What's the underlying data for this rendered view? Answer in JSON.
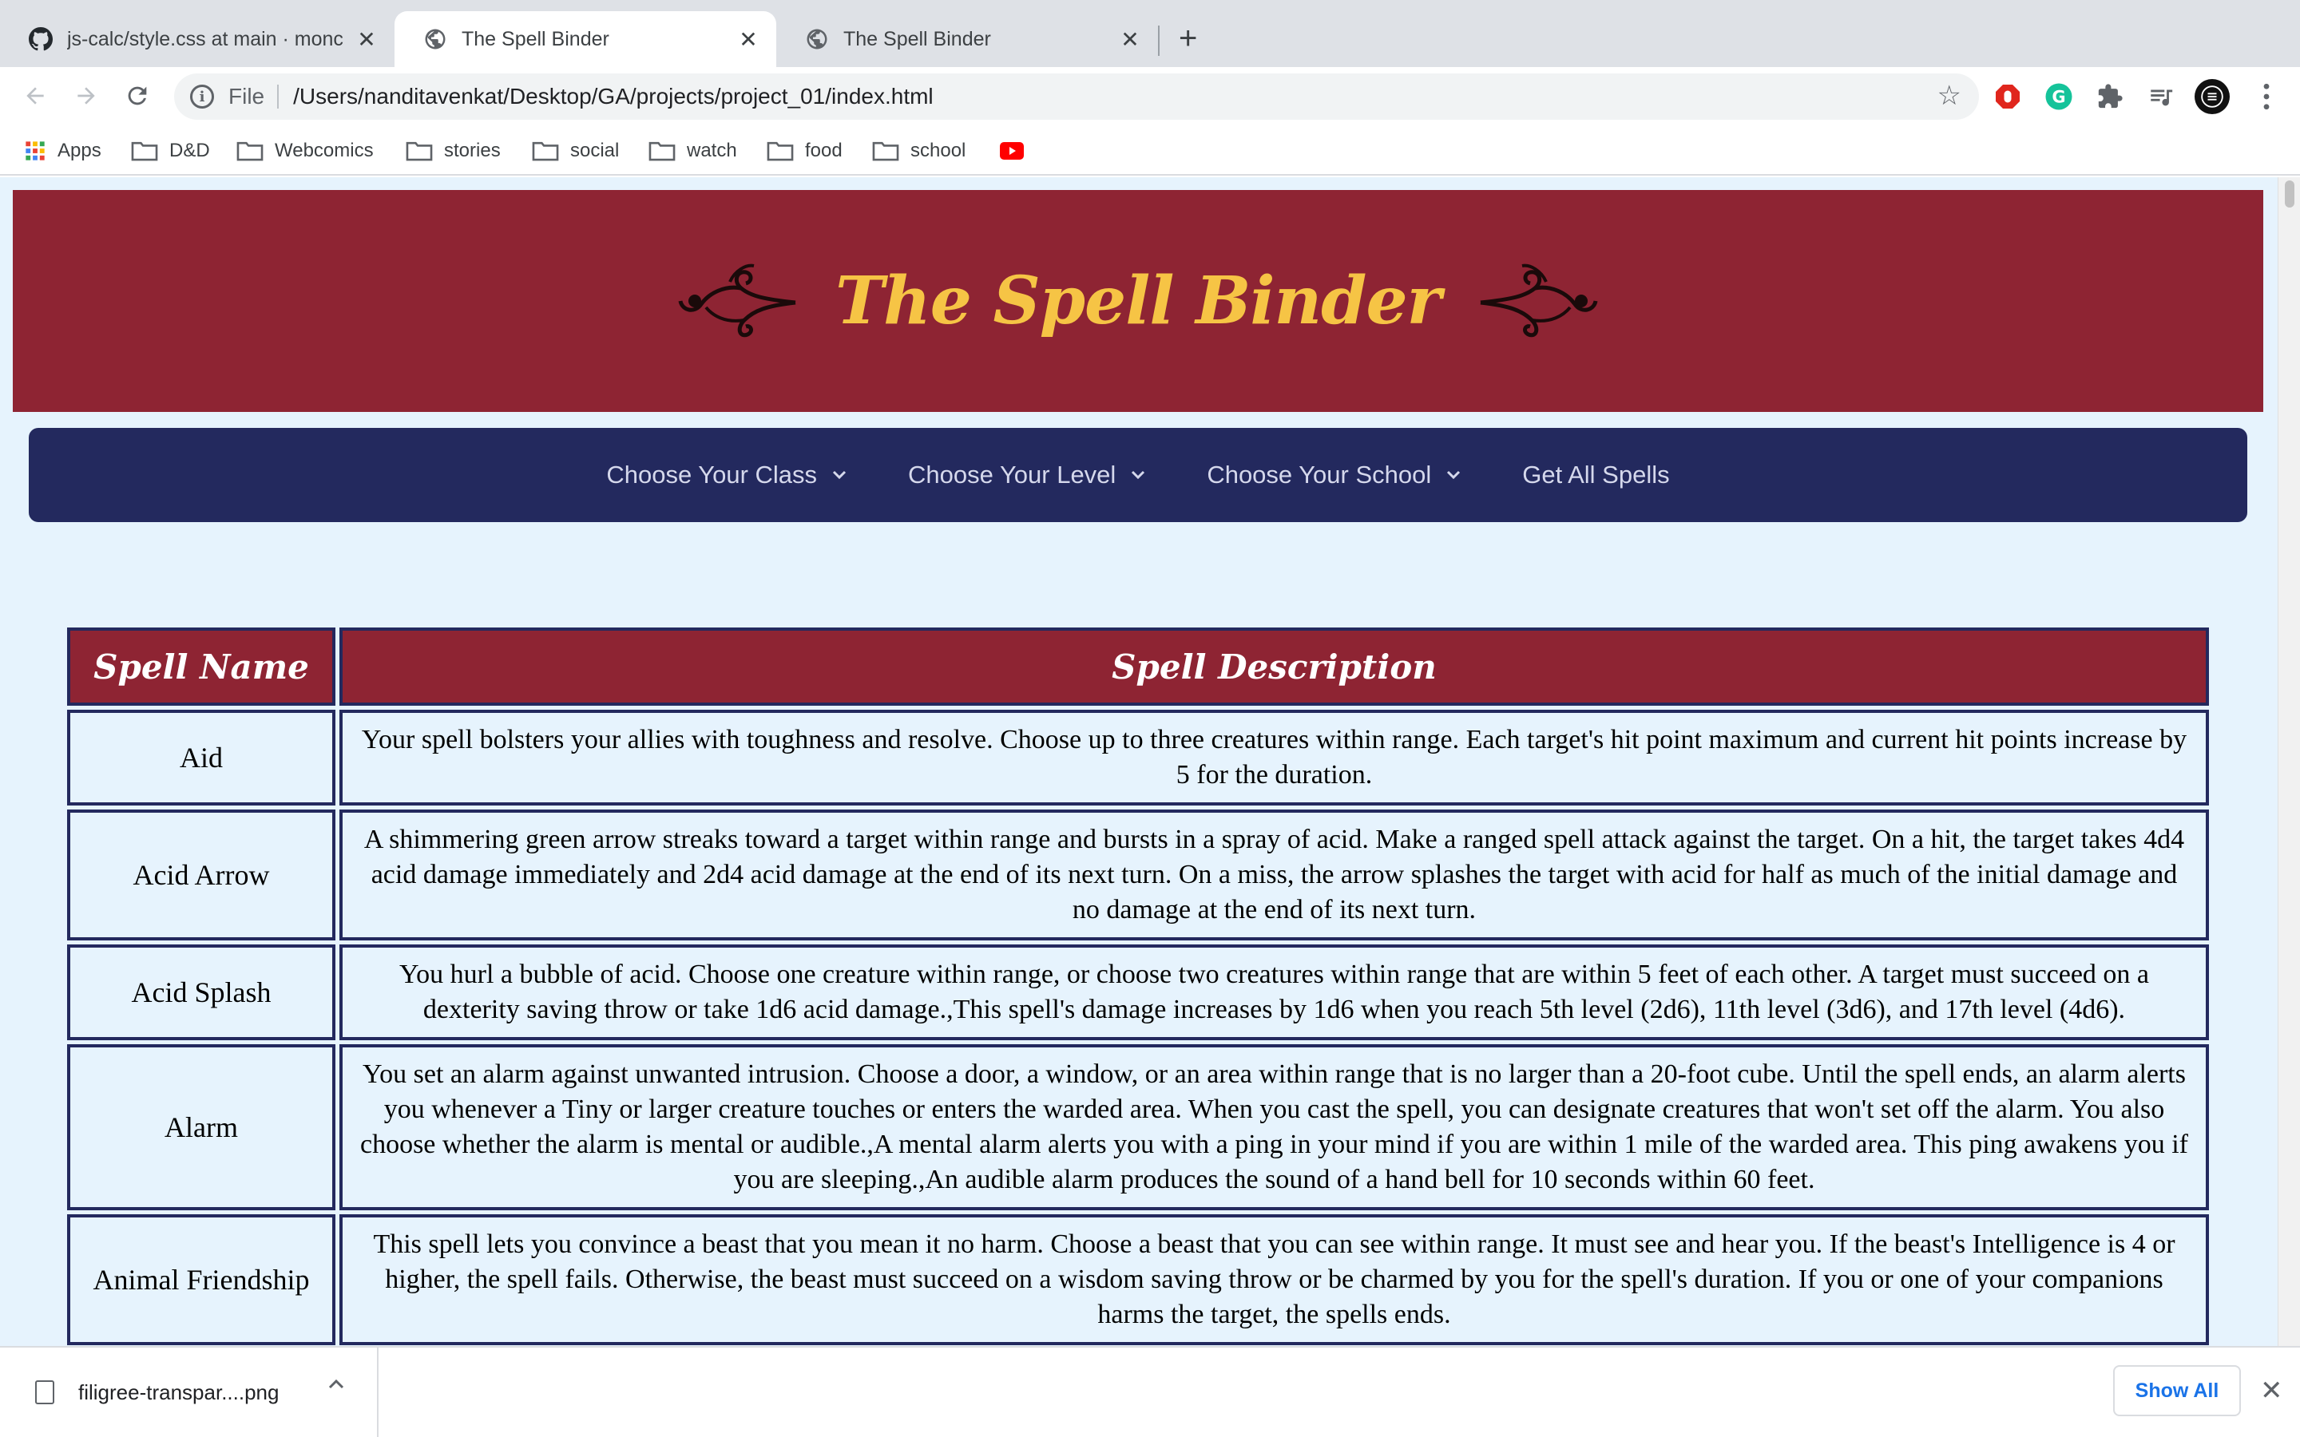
{
  "browser": {
    "tabs": [
      {
        "title": "js-calc/style.css at main · monc",
        "icon": "github-icon"
      },
      {
        "title": "The Spell Binder",
        "icon": "globe-icon"
      },
      {
        "title": "The Spell Binder",
        "icon": "globe-icon"
      }
    ],
    "address": {
      "scheme": "File",
      "url": "/Users/nanditavenkat/Desktop/GA/projects/project_01/index.html"
    },
    "bookmarks": [
      {
        "label": "Apps",
        "icon": "apps-grid-icon"
      },
      {
        "label": "D&D",
        "icon": "folder-icon"
      },
      {
        "label": "Webcomics",
        "icon": "folder-icon"
      },
      {
        "label": "stories",
        "icon": "folder-icon"
      },
      {
        "label": "social",
        "icon": "folder-icon"
      },
      {
        "label": "watch",
        "icon": "folder-icon"
      },
      {
        "label": "food",
        "icon": "folder-icon"
      },
      {
        "label": "school",
        "icon": "folder-icon"
      },
      {
        "label": "",
        "icon": "youtube-icon"
      }
    ]
  },
  "page": {
    "title": "The Spell Binder",
    "nav": {
      "class_label": "Choose Your Class",
      "level_label": "Choose Your Level",
      "school_label": "Choose Your School",
      "all_label": "Get All Spells"
    },
    "table": {
      "headers": {
        "name": "Spell Name",
        "description": "Spell Description"
      },
      "rows": [
        {
          "name": "Aid",
          "description": "Your spell bolsters your allies with toughness and resolve. Choose up to three creatures within range. Each target's hit point maximum and current hit points increase by 5 for the duration."
        },
        {
          "name": "Acid Arrow",
          "description": "A shimmering green arrow streaks toward a target within range and bursts in a spray of acid. Make a ranged spell attack against the target. On a hit, the target takes 4d4 acid damage immediately and 2d4 acid damage at the end of its next turn. On a miss, the arrow splashes the target with acid for half as much of the initial damage and no damage at the end of its next turn."
        },
        {
          "name": "Acid Splash",
          "description": "You hurl a bubble of acid. Choose one creature within range, or choose two creatures within range that are within 5 feet of each other. A target must succeed on a dexterity saving throw or take 1d6 acid damage.,This spell's damage increases by 1d6 when you reach 5th level (2d6), 11th level (3d6), and 17th level (4d6)."
        },
        {
          "name": "Alarm",
          "description": "You set an alarm against unwanted intrusion. Choose a door, a window, or an area within range that is no larger than a 20-foot cube. Until the spell ends, an alarm alerts you whenever a Tiny or larger creature touches or enters the warded area. When you cast the spell, you can designate creatures that won't set off the alarm. You also choose whether the alarm is mental or audible.,A mental alarm alerts you with a ping in your mind if you are within 1 mile of the warded area. This ping awakens you if you are sleeping.,An audible alarm produces the sound of a hand bell for 10 seconds within 60 feet."
        },
        {
          "name": "Animal Friendship",
          "description": "This spell lets you convince a beast that you mean it no harm. Choose a beast that you can see within range. It must see and hear you. If the beast's Intelligence is 4 or higher, the spell fails. Otherwise, the beast must succeed on a wisdom saving throw or be charmed by you for the spell's duration. If you or one of your companions harms the target, the spells ends."
        }
      ]
    }
  },
  "downloads": {
    "file_name": "filigree-transpar....png",
    "show_all_label": "Show All"
  },
  "colors": {
    "banner": "#8e2433",
    "title_gold": "#f6c445",
    "navbar": "#23295e",
    "page_bg": "#e6f3fd"
  }
}
